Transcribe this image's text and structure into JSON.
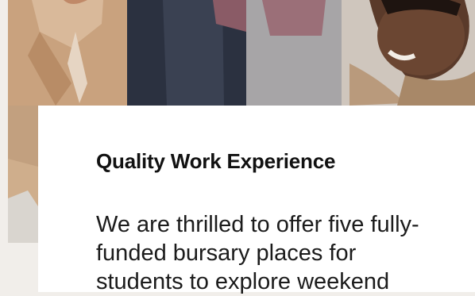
{
  "card": {
    "title": "Quality Work Experience",
    "body": "We are thrilled to offer five fully-funded bursary places for students to explore weekend"
  }
}
